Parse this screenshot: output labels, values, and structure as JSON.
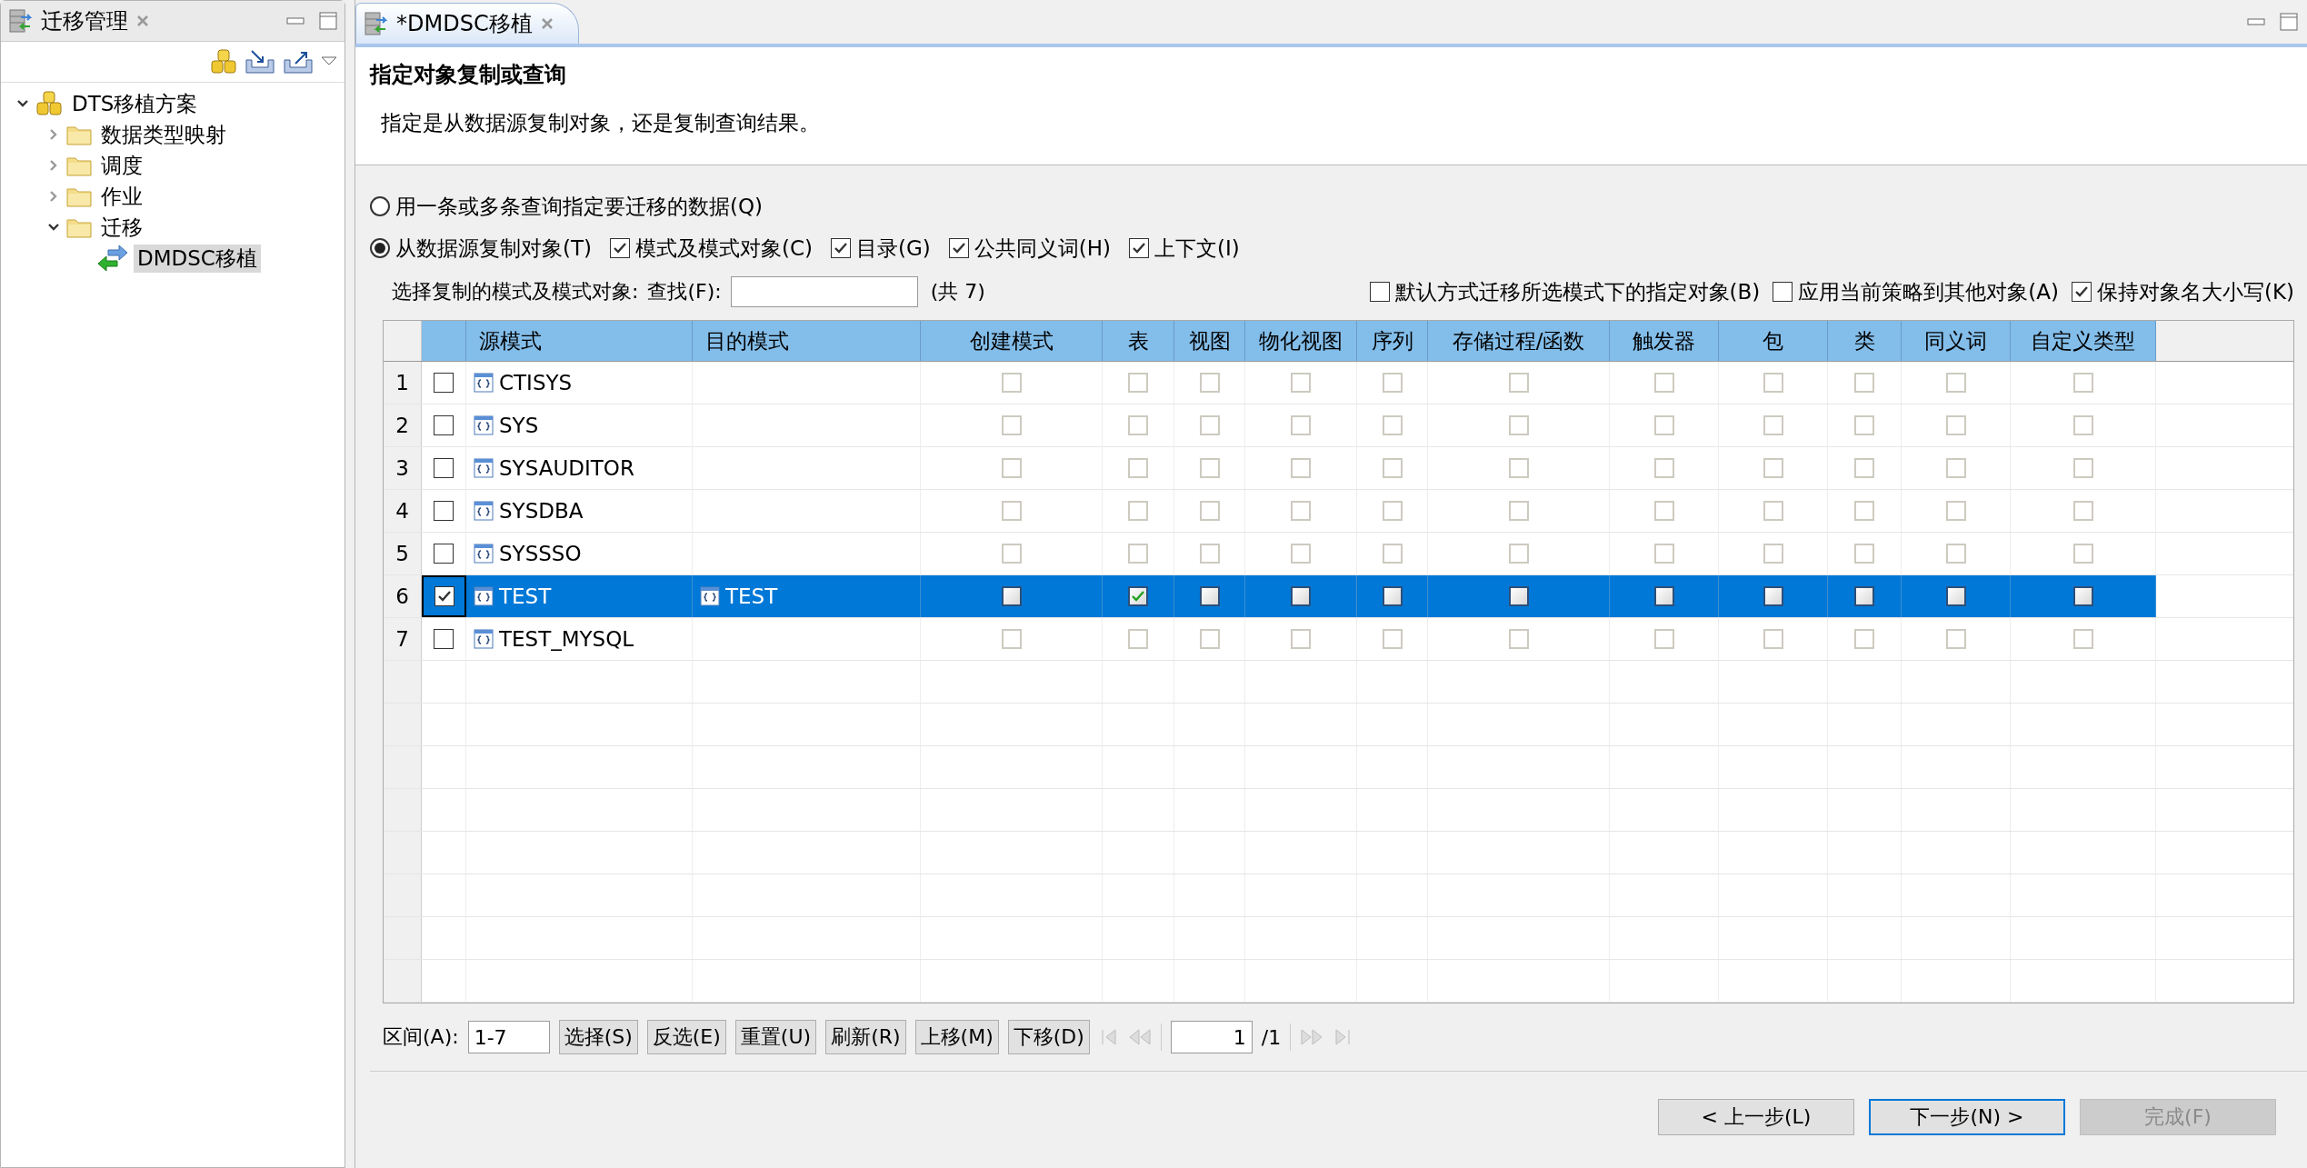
{
  "left_panel": {
    "title": "迁移管理",
    "tree": [
      {
        "label": "DTS移植方案",
        "kind": "project",
        "expanded": true,
        "selected": false,
        "children": [
          {
            "label": "数据类型映射",
            "kind": "folder",
            "expanded": false,
            "selected": false
          },
          {
            "label": "调度",
            "kind": "folder",
            "expanded": false,
            "selected": false
          },
          {
            "label": "作业",
            "kind": "folder",
            "expanded": false,
            "selected": false
          },
          {
            "label": "迁移",
            "kind": "folder",
            "expanded": true,
            "selected": false,
            "children": [
              {
                "label": "DMDSC移植",
                "kind": "migration",
                "selected": true
              }
            ]
          }
        ]
      }
    ]
  },
  "editor": {
    "tab_title": "*DMDSC移植",
    "heading": "指定对象复制或查询",
    "description": "指定是从数据源复制对象，还是复制查询结果。"
  },
  "source_options": [
    {
      "label": "用一条或多条查询指定要迁移的数据(Q)",
      "selected": false
    },
    {
      "label": "从数据源复制对象(T)",
      "selected": true
    }
  ],
  "object_options": [
    {
      "label": "模式及模式对象(C)",
      "checked": true
    },
    {
      "label": "目录(G)",
      "checked": true
    },
    {
      "label": "公共同义词(H)",
      "checked": true
    },
    {
      "label": "上下文(I)",
      "checked": true
    }
  ],
  "filter": {
    "label": "选择复制的模式及模式对象:",
    "search_label": "查找(F):",
    "count": "(共 7)"
  },
  "extra_options": [
    {
      "label": "默认方式迁移所选模式下的指定对象(B)",
      "checked": false
    },
    {
      "label": "应用当前策略到其他对象(A)",
      "checked": false
    },
    {
      "label": "保持对象名大小写(K)",
      "checked": true
    }
  ],
  "table": {
    "columns": [
      "源模式",
      "目的模式",
      "创建模式",
      "表",
      "视图",
      "物化视图",
      "序列",
      "存储过程/函数",
      "触发器",
      "包",
      "类",
      "同义词",
      "自定义类型"
    ],
    "rows": [
      {
        "index": "1",
        "selected": false,
        "checked": false,
        "source": "CTISYS",
        "flags": [
          false,
          false,
          false,
          false,
          false,
          false,
          false,
          false,
          false,
          false,
          false
        ]
      },
      {
        "index": "2",
        "selected": false,
        "checked": false,
        "source": "SYS",
        "flags": [
          false,
          false,
          false,
          false,
          false,
          false,
          false,
          false,
          false,
          false,
          false
        ]
      },
      {
        "index": "3",
        "selected": false,
        "checked": false,
        "source": "SYSAUDITOR",
        "flags": [
          false,
          false,
          false,
          false,
          false,
          false,
          false,
          false,
          false,
          false,
          false
        ]
      },
      {
        "index": "4",
        "selected": false,
        "checked": false,
        "source": "SYSDBA",
        "flags": [
          false,
          false,
          false,
          false,
          false,
          false,
          false,
          false,
          false,
          false,
          false
        ]
      },
      {
        "index": "5",
        "selected": false,
        "checked": false,
        "source": "SYSSSO",
        "flags": [
          false,
          false,
          false,
          false,
          false,
          false,
          false,
          false,
          false,
          false,
          false
        ]
      },
      {
        "index": "6",
        "selected": true,
        "checked": true,
        "source": "TEST",
        "target": "TEST",
        "flags": [
          false,
          true,
          false,
          false,
          false,
          false,
          false,
          false,
          false,
          false,
          false
        ]
      },
      {
        "index": "7",
        "selected": false,
        "checked": false,
        "source": "TEST_MYSQL",
        "flags": [
          false,
          false,
          false,
          false,
          false,
          false,
          false,
          false,
          false,
          false,
          false
        ]
      }
    ]
  },
  "range": {
    "label": "区间(A):",
    "value": "1-7"
  },
  "list_buttons": [
    "选择(S)",
    "反选(E)",
    "重置(U)",
    "刷新(R)",
    "上移(M)",
    "下移(D)"
  ],
  "pager": {
    "page": "1",
    "total": "/1"
  },
  "wizard_buttons": [
    {
      "label": "< 上一步(L)",
      "default": false,
      "disabled": false
    },
    {
      "label": "下一步(N) >",
      "default": true,
      "disabled": false
    },
    {
      "label": "完成(F)",
      "default": false,
      "disabled": true
    }
  ]
}
